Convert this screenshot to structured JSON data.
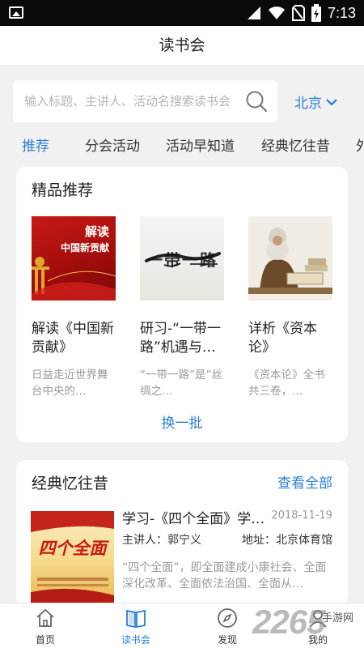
{
  "status": {
    "time": "7:13"
  },
  "header": {
    "title": "读书会"
  },
  "search": {
    "placeholder": "输入标题、主讲人、活动名搜索读书会",
    "city": "北京"
  },
  "tabs": [
    {
      "label": "推荐"
    },
    {
      "label": "分会活动"
    },
    {
      "label": "活动早知道"
    },
    {
      "label": "经典忆往昔"
    },
    {
      "label": "外"
    }
  ],
  "featured": {
    "heading": "精品推荐",
    "items": [
      {
        "title": "解读《中国新贡献》",
        "desc": "日益走近世界舞台中央的…",
        "cover_text_1": "解读",
        "cover_text_2": "中国新贡献"
      },
      {
        "title": "研习-“一带一路”机遇与…",
        "desc": "“一带一路”是”丝绸之…",
        "cover_text_1": "一带一路"
      },
      {
        "title": "详析《资本论》",
        "desc": "《资本论》全书共三卷，…"
      }
    ],
    "refresh_label": "换一批"
  },
  "classics": {
    "heading": "经典忆往昔",
    "see_all": "查看全部",
    "item": {
      "title": "学习-《四个全面》学…",
      "date": "2018-11-19",
      "speaker": "主讲人：郭宁义",
      "address": "地址：北京体育馆",
      "desc": "“四个全面”，即全面建成小康社会、全面深化改革、全面依法治国、全面从…",
      "cover_text": "四个全面"
    }
  },
  "bottom_nav": [
    {
      "label": "首页",
      "icon": "home-icon"
    },
    {
      "label": "读书会",
      "icon": "book-icon"
    },
    {
      "label": "发现",
      "icon": "compass-icon"
    },
    {
      "label": "我的",
      "icon": "person-icon"
    }
  ],
  "watermark": {
    "number": "2265",
    "site": "手游网"
  },
  "colors": {
    "accent": "#2a7fd4",
    "background": "#f1f1f1",
    "statusbar": "#0a0a0a"
  }
}
